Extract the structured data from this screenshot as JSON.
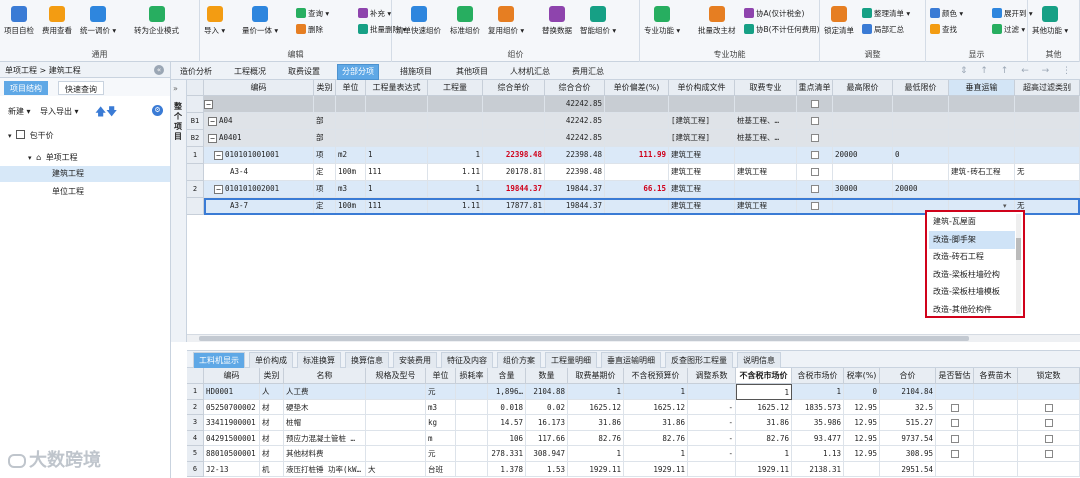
{
  "ribbon": {
    "groups": [
      {
        "label": "通用",
        "buttons": [
          "项目自检",
          "费用查看",
          "统一调价 ▾",
          "转为企业模式"
        ]
      },
      {
        "label": "编辑",
        "buttons": [
          "导入 ▾",
          "量价一体 ▾"
        ],
        "small": [
          "查询 ▾",
          "删除",
          "补充 ▾",
          "批量删除 ▾"
        ]
      },
      {
        "label": "组价",
        "buttons": [
          "清单快速组价",
          "标准组价",
          "复用组价 ▾",
          "替换数据",
          "智能组价 ▾"
        ]
      },
      {
        "label": "专业功能",
        "buttons": [
          "专业功能 ▾",
          "批量改主材"
        ],
        "small": [
          "协A(仅计税金)",
          "协B(不计任何费用)"
        ]
      },
      {
        "label": "调整",
        "buttons": [
          "锁定清单"
        ],
        "small": [
          "整理清单 ▾",
          "局部汇总"
        ]
      },
      {
        "label": "显示",
        "small": [
          "颜色 ▾",
          "查找",
          "展开到 ▾",
          "过滤 ▾"
        ]
      },
      {
        "label": "其他",
        "buttons": [
          "其他功能 ▾"
        ]
      }
    ]
  },
  "left": {
    "breadcrumb": "单项工程 > 建筑工程",
    "tabs": [
      "项目结构",
      "快速查询"
    ],
    "toolbar": [
      "新建 ▾",
      "导入导出 ▾"
    ],
    "tree": [
      {
        "label": "包干价",
        "level": 0
      },
      {
        "label": "单项工程",
        "level": 1
      },
      {
        "label": "建筑工程",
        "level": 2,
        "selected": true
      },
      {
        "label": "单位工程",
        "level": 2
      }
    ]
  },
  "doc_tabs": [
    "造价分析",
    "工程概况",
    "取费设置",
    "分部分项",
    "措施项目",
    "其他项目",
    "人材机汇总",
    "费用汇总"
  ],
  "active_doc_tab": "分部分项",
  "side_label": "整个项目",
  "main_grid": {
    "columns": [
      "",
      "编码",
      "类别",
      "单位",
      "工程量表达式",
      "工程量",
      "综合单价",
      "综合合价",
      "单价偏差(%)",
      "单价构成文件",
      "取费专业",
      "重点清单",
      "最高限价",
      "最低限价",
      "垂直运输",
      "超高过滤类别"
    ],
    "rows": [
      {
        "rh": "",
        "code": "",
        "type": "",
        "unit": "",
        "expr": "",
        "qty": "",
        "price": "",
        "total": "42242.85",
        "dev": "",
        "file": "",
        "prof": "",
        "key": true,
        "max": "",
        "min": "",
        "vert": "",
        "over": ""
      },
      {
        "rh": "B1",
        "code": "A04",
        "type": "部",
        "unit": "",
        "expr": "",
        "qty": "",
        "price": "",
        "total": "42242.85",
        "dev": "",
        "file": "[建筑工程]",
        "prof": "桩基工程、…",
        "key": true,
        "max": "",
        "min": "",
        "vert": "",
        "over": ""
      },
      {
        "rh": "B2",
        "code": "A0401",
        "type": "部",
        "unit": "",
        "expr": "",
        "qty": "",
        "price": "",
        "total": "42242.85",
        "dev": "",
        "file": "[建筑工程]",
        "prof": "桩基工程、…",
        "key": true,
        "max": "",
        "min": "",
        "vert": "",
        "over": ""
      },
      {
        "rh": "1",
        "code": "010101001001",
        "type": "项",
        "unit": "m2",
        "expr": "1",
        "qty": "1",
        "price": "22398.48",
        "total": "22398.48",
        "dev": "111.99",
        "file": "建筑工程",
        "prof": "",
        "key": true,
        "max": "20000",
        "min": "0",
        "vert": "",
        "over": ""
      },
      {
        "rh": "",
        "code": "A3-4",
        "type": "定",
        "unit": "100m",
        "expr": "111",
        "qty": "1.11",
        "price": "20178.81",
        "total": "22398.48",
        "dev": "",
        "file": "建筑工程",
        "prof": "建筑工程",
        "key": false,
        "max": "",
        "min": "",
        "vert": "建筑-砖石工程",
        "over": "无"
      },
      {
        "rh": "2",
        "code": "010101002001",
        "type": "项",
        "unit": "m3",
        "expr": "1",
        "qty": "1",
        "price": "19844.37",
        "total": "19844.37",
        "dev": "66.15",
        "file": "建筑工程",
        "prof": "",
        "key": true,
        "max": "30000",
        "min": "20000",
        "vert": "",
        "over": ""
      },
      {
        "rh": "",
        "code": "A3-7",
        "type": "定",
        "unit": "100m",
        "expr": "111",
        "qty": "1.11",
        "price": "17877.81",
        "total": "19844.37",
        "dev": "",
        "file": "建筑工程",
        "prof": "建筑工程",
        "key": false,
        "max": "",
        "min": "",
        "vert": "",
        "over": "无"
      }
    ]
  },
  "dropdown": {
    "items": [
      "建筑-瓦屋面",
      "改造-脚手架",
      "改造-砖石工程",
      "改造-梁板柱墙砼构",
      "改造-梁板柱墙模板",
      "改造-其他砼构件"
    ],
    "selected": "改造-脚手架"
  },
  "bottom_tabs": [
    "工料机显示",
    "单价构成",
    "标准换算",
    "换算信息",
    "安装费用",
    "特征及内容",
    "组价方案",
    "工程量明细",
    "垂直运输明细",
    "反查图形工程量",
    "说明信息"
  ],
  "active_bottom_tab": "工料机显示",
  "bottom_grid": {
    "columns": [
      "",
      "编码",
      "类别",
      "名称",
      "规格及型号",
      "单位",
      "损耗率",
      "含量",
      "数量",
      "取费基期价",
      "不含税预算价",
      "调整系数",
      "不含税市场价",
      "含税市场价",
      "税率(%)",
      "合价",
      "是否暂估",
      "各费苗木",
      "锁定数"
    ],
    "rows": [
      [
        "1",
        "HD0001",
        "人",
        "人工费",
        "",
        "元",
        "",
        "1,896…",
        "2104.88",
        "1",
        "1",
        "",
        "1",
        "1",
        "0",
        "2104.84",
        "",
        "",
        ""
      ],
      [
        "2",
        "05250700002",
        "材",
        "硬垫木",
        "",
        "m3",
        "",
        "0.018",
        "0.02",
        "1625.12",
        "1625.12",
        "-",
        "1625.12",
        "1835.573",
        "12.95",
        "32.5",
        "chk",
        "",
        "chk"
      ],
      [
        "3",
        "33411900001",
        "材",
        "桩帽",
        "",
        "kg",
        "",
        "14.57",
        "16.173",
        "31.86",
        "31.86",
        "-",
        "31.86",
        "35.986",
        "12.95",
        "515.27",
        "chk",
        "",
        "chk"
      ],
      [
        "4",
        "04291500001",
        "材",
        "预应力混凝土管桩 …",
        "",
        "m",
        "",
        "106",
        "117.66",
        "82.76",
        "82.76",
        "-",
        "82.76",
        "93.477",
        "12.95",
        "9737.54",
        "chk",
        "",
        "chk"
      ],
      [
        "5",
        "88010500001",
        "材",
        "其他材料费",
        "",
        "元",
        "",
        "278.331",
        "308.947",
        "1",
        "1",
        "-",
        "1",
        "1.13",
        "12.95",
        "308.95",
        "chk",
        "",
        "chk"
      ],
      [
        "6",
        "J2-13",
        "机",
        "液压打桩锤 功率(kW…",
        "大",
        "台班",
        "",
        "1.378",
        "1.53",
        "1929.11",
        "1929.11",
        "",
        "1929.11",
        "2138.31",
        "",
        "2951.54",
        "",
        "",
        ""
      ]
    ]
  },
  "watermark": "大数跨境"
}
